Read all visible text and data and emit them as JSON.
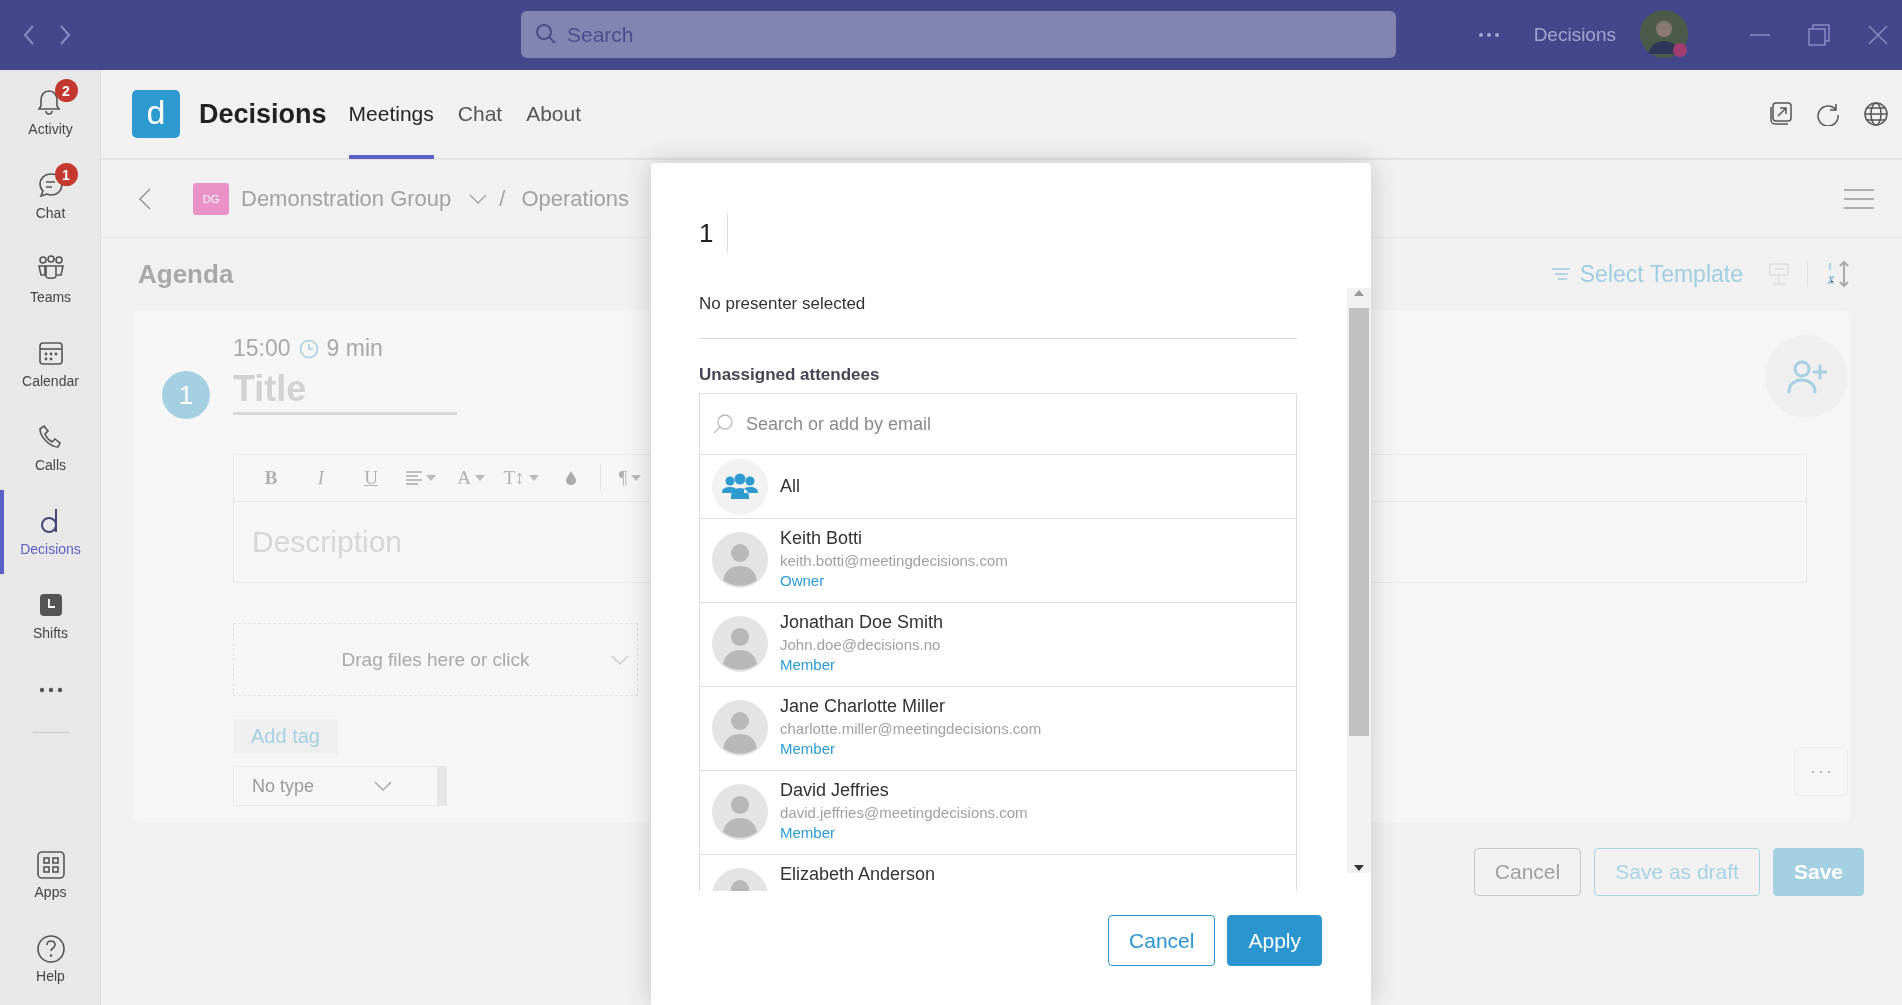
{
  "title_bar": {
    "search": {
      "placeholder": "Search"
    },
    "org_name": "Decisions"
  },
  "rail": {
    "items": [
      {
        "label": "Activity",
        "badge": "2",
        "selected": false
      },
      {
        "label": "Chat",
        "badge": "1",
        "selected": false
      },
      {
        "label": "Teams",
        "selected": false
      },
      {
        "label": "Calendar",
        "selected": false
      },
      {
        "label": "Calls",
        "selected": false
      },
      {
        "label": "Decisions",
        "selected": true
      },
      {
        "label": "Shifts",
        "selected": false
      }
    ],
    "bottom_items": [
      {
        "label": "Apps",
        "selected": false
      },
      {
        "label": "Help",
        "selected": false
      }
    ]
  },
  "app_header": {
    "logo": "d",
    "name": "Decisions",
    "tabs": [
      {
        "label": "Meetings",
        "selected": true
      },
      {
        "label": "Chat",
        "selected": false
      },
      {
        "label": "About",
        "selected": false
      }
    ]
  },
  "breadcrumb": {
    "group_badge": "DG",
    "group": "Demonstration Group",
    "separator": "/",
    "folder": "Operations"
  },
  "agenda": {
    "heading": "Agenda",
    "select_template": "Select Template",
    "items": [
      {
        "number": "1",
        "time": "15:00",
        "duration": "9 min",
        "title_placeholder": "Title",
        "toolbar": [
          {
            "kind": "bold",
            "label": "B"
          },
          {
            "kind": "italic",
            "label": "I"
          },
          {
            "kind": "underline",
            "label": "U"
          },
          {
            "kind": "align"
          },
          {
            "kind": "font-color",
            "label": "A"
          },
          {
            "kind": "font-size",
            "label": "T↕"
          },
          {
            "kind": "fill"
          },
          {
            "kind": "paragraph",
            "label": "¶"
          }
        ],
        "description_placeholder": "Description",
        "dropzone": "Drag files here or click",
        "add_tag": "Add tag",
        "type": "No type"
      }
    ],
    "buttons": [
      {
        "label": "Cancel",
        "kind": "secondary"
      },
      {
        "label": "Save as draft",
        "kind": "outline"
      },
      {
        "label": "Save",
        "kind": "primary"
      }
    ]
  },
  "dialog": {
    "number": "1",
    "presenter": "No presenter selected",
    "section": "Unassigned attendees",
    "search": {
      "placeholder": "Search or add by email"
    },
    "attendees": [
      {
        "kind": "group",
        "name": "All"
      },
      {
        "kind": "person",
        "name": "Keith Botti",
        "email": "keith.botti@meetingdecisions.com",
        "role": "Owner"
      },
      {
        "kind": "person",
        "name": "Jonathan Doe Smith",
        "email": "John.doe@decisions.no",
        "role": "Member"
      },
      {
        "kind": "person",
        "name": "Jane Charlotte Miller",
        "email": "charlotte.miller@meetingdecisions.com",
        "role": "Member"
      },
      {
        "kind": "person",
        "name": "David Jeffries",
        "email": "david.jeffries@meetingdecisions.com",
        "role": "Member"
      },
      {
        "kind": "person",
        "name": "Elizabeth Anderson"
      }
    ],
    "buttons": [
      {
        "label": "Cancel",
        "kind": "secondary"
      },
      {
        "label": "Apply",
        "kind": "primary"
      }
    ]
  }
}
